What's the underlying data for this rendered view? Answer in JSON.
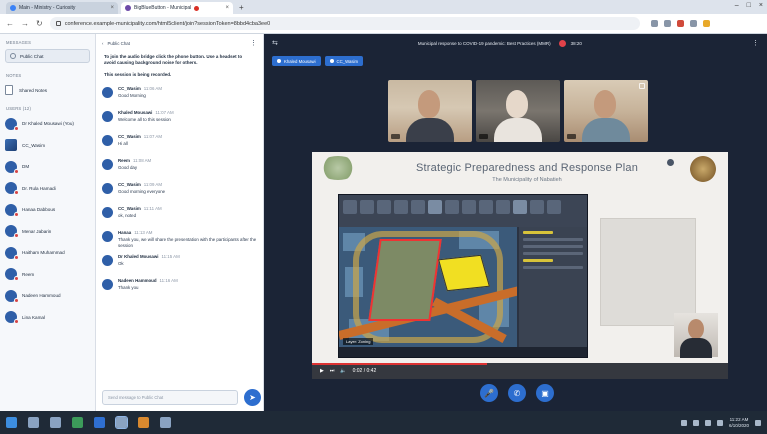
{
  "browser": {
    "tabs": [
      {
        "label": "Main - Ministry - Curiosity"
      },
      {
        "label": "BigBlueButton - Municipal",
        "active": true
      }
    ],
    "address": "conference.example-municipality.com/html5client/join?sessionToken=8bbd4cba3ee0"
  },
  "sidebar": {
    "messages_header": "MESSAGES",
    "public_chat": "Public Chat",
    "notes_header": "NOTES",
    "shared_notes": "Shared Notes",
    "users_header": "USERS (12)",
    "users": [
      {
        "name": "Dr Khaled Mousawi (You)"
      },
      {
        "name": "CC_Wasim"
      },
      {
        "name": "DM"
      },
      {
        "name": "Dr. Rula Hamadi"
      },
      {
        "name": "Hanaa Dabbous"
      },
      {
        "name": "Menar Jabarin"
      },
      {
        "name": "Haitham Muhammad"
      },
      {
        "name": "Reem"
      },
      {
        "name": "Nadeen Hammoud"
      },
      {
        "name": "Lina Kamal"
      }
    ]
  },
  "chat": {
    "header": "Public Chat",
    "notice": "To join the audio bridge click the phone button. Use a headset to avoid causing background noise for others.",
    "notice2": "This session is being recorded.",
    "messages": [
      {
        "sender": "CC_Wasim",
        "time": "11:06 AM",
        "text": "Good Morning"
      },
      {
        "sender": "Khaled Mousawi",
        "time": "11:07 AM",
        "text": "Welcome all to this session"
      },
      {
        "sender": "CC_Wasim",
        "time": "11:07 AM",
        "text": "Hi all"
      },
      {
        "sender": "Reem",
        "time": "11:08 AM",
        "text": "Good day"
      },
      {
        "sender": "CC_Wasim",
        "time": "11:09 AM",
        "text": "Good morning everyone"
      },
      {
        "sender": "CC_Wasim",
        "time": "11:11 AM",
        "text": "ok, noted"
      },
      {
        "sender": "Hanaa",
        "time": "11:13 AM",
        "text": "Thank you, we will share the presentation with the participants after the session"
      },
      {
        "sender": "Dr Khaled Mousawi",
        "time": "11:15 AM",
        "text": "Ok"
      },
      {
        "sender": "Nadeen Hammoud",
        "time": "11:16 AM",
        "text": "Thank you"
      }
    ],
    "input_placeholder": "Send message to Public Chat"
  },
  "stage": {
    "title": "Municipal response to COVID-19 pandemic: Best Practices (MMR)",
    "timer": "38:20",
    "chips": [
      "Khaled Mousawi",
      "CC_Wasim"
    ],
    "slide_title": "Strategic Preparedness and Response Plan",
    "slide_subtitle": "The Municipality of Nabatieh",
    "gis_caption": "Layer: Zoning",
    "video_time": "0:02 / 0:42",
    "video_progress": 0.42
  },
  "taskbar": {
    "clock_time": "11:22 AM",
    "clock_date": "6/10/2020"
  },
  "colors": {
    "accent": "#2d6ecf",
    "stage_bg": "#1b2436",
    "record": "#e2424a"
  }
}
